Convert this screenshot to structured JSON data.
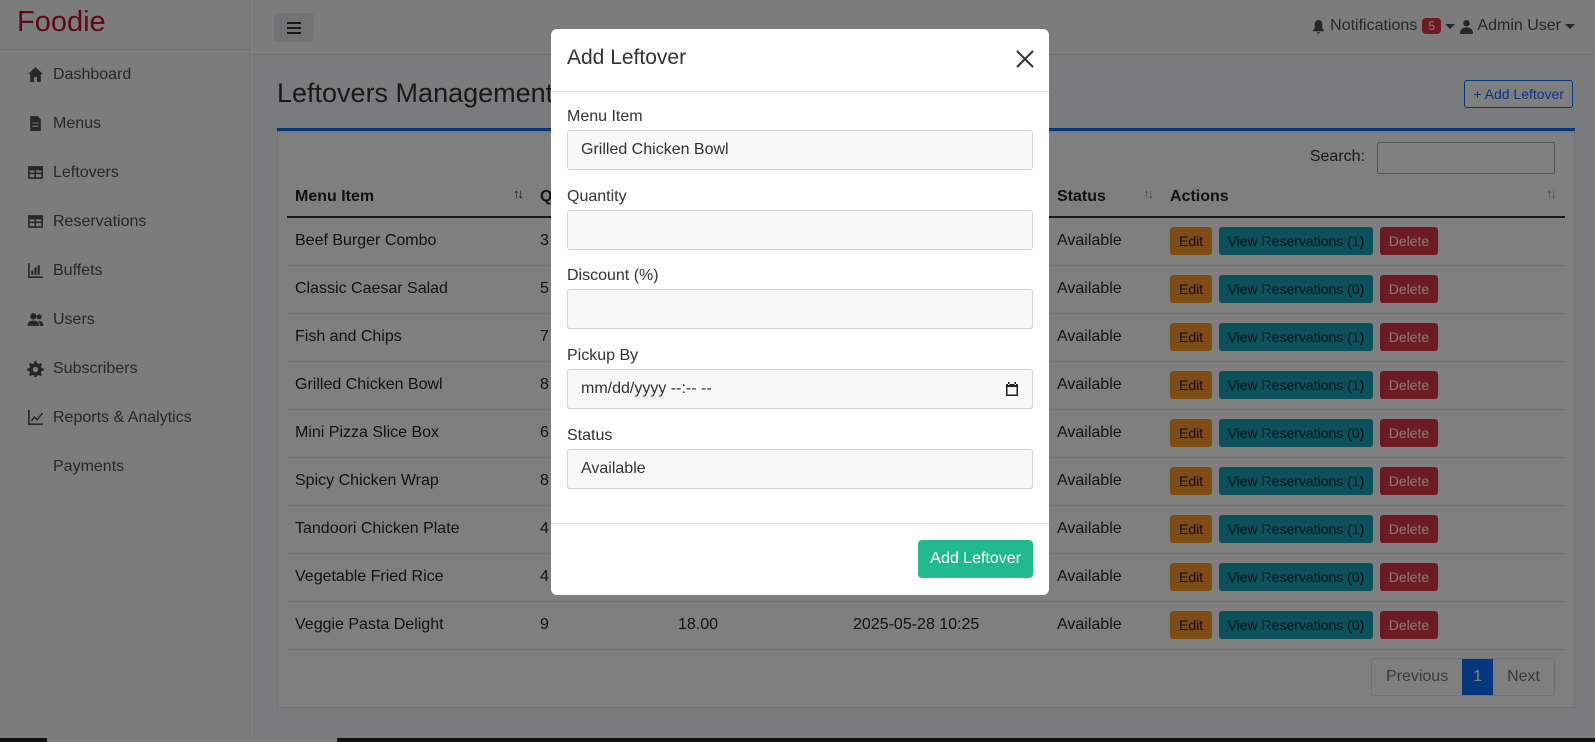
{
  "brand": "Foodie",
  "sidebar": {
    "items": [
      {
        "label": "Dashboard"
      },
      {
        "label": "Menus"
      },
      {
        "label": "Leftovers"
      },
      {
        "label": "Reservations"
      },
      {
        "label": "Buffets"
      },
      {
        "label": "Users"
      },
      {
        "label": "Subscribers"
      },
      {
        "label": "Reports & Analytics"
      },
      {
        "label": "Payments"
      }
    ]
  },
  "topbar": {
    "notifications_label": "Notifications",
    "notifications_count": "5",
    "user_label": "Admin User"
  },
  "main": {
    "title": "Leftovers Management",
    "add_button": "+ Add Leftover",
    "search_label": "Search:",
    "columns": [
      "Menu Item",
      "Q",
      "",
      "",
      "Status",
      "Actions"
    ],
    "rows": [
      {
        "item": "Beef Burger Combo",
        "qty": "3",
        "price": "",
        "pickup": "",
        "status": "Available",
        "view": "View Reservations (1)"
      },
      {
        "item": "Classic Caesar Salad",
        "qty": "5",
        "price": "",
        "pickup": "",
        "status": "Available",
        "view": "View Reservations (0)"
      },
      {
        "item": "Fish and Chips",
        "qty": "7",
        "price": "",
        "pickup": "",
        "status": "Available",
        "view": "View Reservations (1)"
      },
      {
        "item": "Grilled Chicken Bowl",
        "qty": "8",
        "price": "",
        "pickup": "",
        "status": "Available",
        "view": "View Reservations (1)"
      },
      {
        "item": "Mini Pizza Slice Box",
        "qty": "6",
        "price": "",
        "pickup": "",
        "status": "Available",
        "view": "View Reservations (0)"
      },
      {
        "item": "Spicy Chicken Wrap",
        "qty": "8",
        "price": "",
        "pickup": "",
        "status": "Available",
        "view": "View Reservations (1)"
      },
      {
        "item": "Tandoori Chicken Plate",
        "qty": "4",
        "price": "",
        "pickup": "",
        "status": "Available",
        "view": "View Reservations (1)"
      },
      {
        "item": "Vegetable Fried Rice",
        "qty": "4",
        "price": "",
        "pickup": "",
        "status": "Available",
        "view": "View Reservations (0)"
      },
      {
        "item": "Veggie Pasta Delight",
        "qty": "9",
        "price": "18.00",
        "pickup": "2025-05-28 10:25",
        "status": "Available",
        "view": "View Reservations (0)"
      }
    ],
    "edit_label": "Edit",
    "delete_label": "Delete",
    "pager": {
      "previous": "Previous",
      "page": "1",
      "next": "Next"
    }
  },
  "modal": {
    "title": "Add Leftover",
    "menu_item_label": "Menu Item",
    "menu_item_value": "Grilled Chicken Bowl",
    "quantity_label": "Quantity",
    "quantity_value": "",
    "discount_label": "Discount (%)",
    "discount_value": "",
    "pickup_label": "Pickup By",
    "pickup_placeholder": "mm/dd/yyyy --:-- --",
    "status_label": "Status",
    "status_value": "Available",
    "submit": "Add Leftover"
  }
}
